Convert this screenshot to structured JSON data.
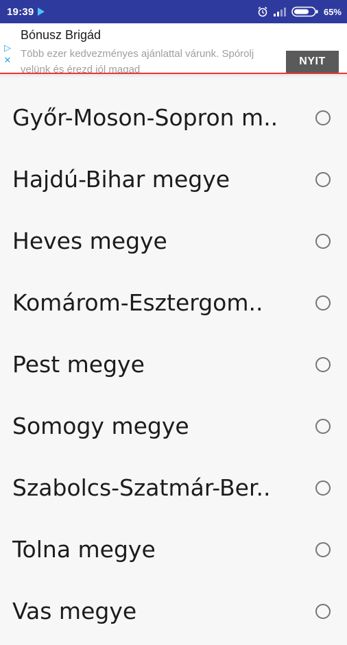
{
  "status_bar": {
    "time": "19:39",
    "battery": "65%",
    "icons": [
      "play-store-icon",
      "alarm-icon",
      "signal-icon",
      "battery-icon"
    ]
  },
  "ad": {
    "title": "Bónusz Brigád",
    "text": "Több ezer kedvezményes ajánlattal várunk. Spórolj velünk és érezd jól magad",
    "open_label": "NYIT",
    "icons": [
      "ad-choices-icon",
      "close-icon"
    ]
  },
  "counties": [
    {
      "label": "Győr-Moson-Sopron m..",
      "selected": false
    },
    {
      "label": "Hajdú-Bihar megye",
      "selected": false
    },
    {
      "label": "Heves megye",
      "selected": false
    },
    {
      "label": "Komárom-Esztergom..",
      "selected": false
    },
    {
      "label": "Pest megye",
      "selected": false
    },
    {
      "label": "Somogy megye",
      "selected": false
    },
    {
      "label": "Szabolcs-Szatmár-Ber..",
      "selected": false
    },
    {
      "label": "Tolna megye",
      "selected": false
    },
    {
      "label": "Vas megye",
      "selected": false
    }
  ],
  "colors": {
    "status_bar": "#2f3a9e",
    "accent_line": "#e53935",
    "ad_button": "#5a5a5a",
    "radio_border": "#757575"
  }
}
